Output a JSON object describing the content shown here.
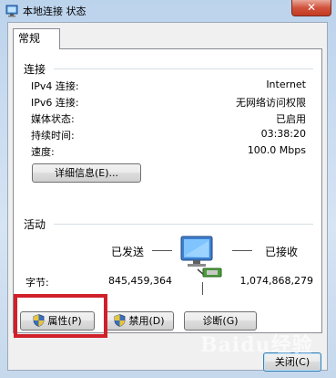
{
  "window": {
    "title": "本地连接 状态",
    "close_glyph": "✕"
  },
  "tabs": [
    {
      "label": "常规"
    }
  ],
  "connection": {
    "section_label": "连接",
    "rows": [
      {
        "label": "IPv4 连接:",
        "value": "Internet"
      },
      {
        "label": "IPv6 连接:",
        "value": "无网络访问权限"
      },
      {
        "label": "媒体状态:",
        "value": "已启用"
      },
      {
        "label": "持续时间:",
        "value": "03:38:20"
      },
      {
        "label": "速度:",
        "value": "100.0 Mbps"
      }
    ],
    "details_button": "详细信息(E)..."
  },
  "activity": {
    "section_label": "活动",
    "sent_label": "已发送",
    "received_label": "已接收",
    "bytes_label": "字节:",
    "bytes_sent": "845,459,364",
    "bytes_received": "1,074,868,279"
  },
  "buttons": {
    "properties": "属性(P)",
    "disable": "禁用(D)",
    "diagnose": "诊断(G)",
    "close": "关闭(C)"
  },
  "watermark": "Baidu经验",
  "colors": {
    "highlight": "#d0202a",
    "close_button": "#c33a22",
    "frame": "#bcd3ec"
  }
}
